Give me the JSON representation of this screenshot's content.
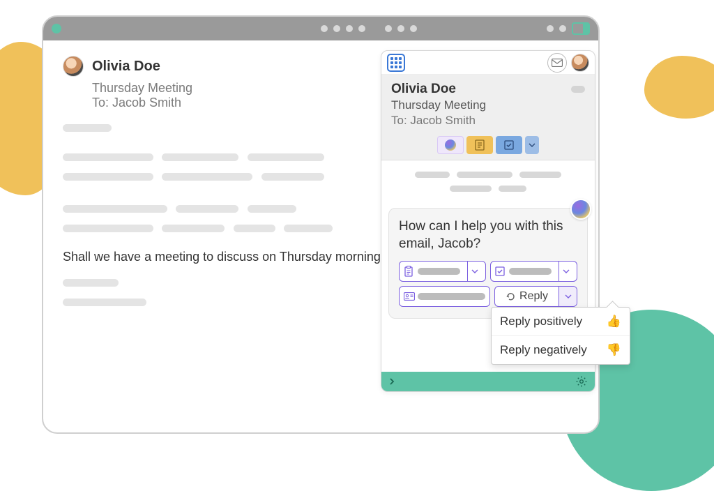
{
  "email": {
    "sender": "Olivia Doe",
    "subject": "Thursday Meeting",
    "to_line": "To: Jacob Smith",
    "body_text": "Shall we have a meeting to discuss on Thursday morning?"
  },
  "assistant": {
    "sender": "Olivia Doe",
    "subject": "Thursday Meeting",
    "to_line": "To: Jacob Smith",
    "prompt": "How can I help you with this email, Jacob?",
    "reply_label": "Reply",
    "dropdown": {
      "positive": "Reply positively",
      "negative": "Reply negatively"
    }
  }
}
